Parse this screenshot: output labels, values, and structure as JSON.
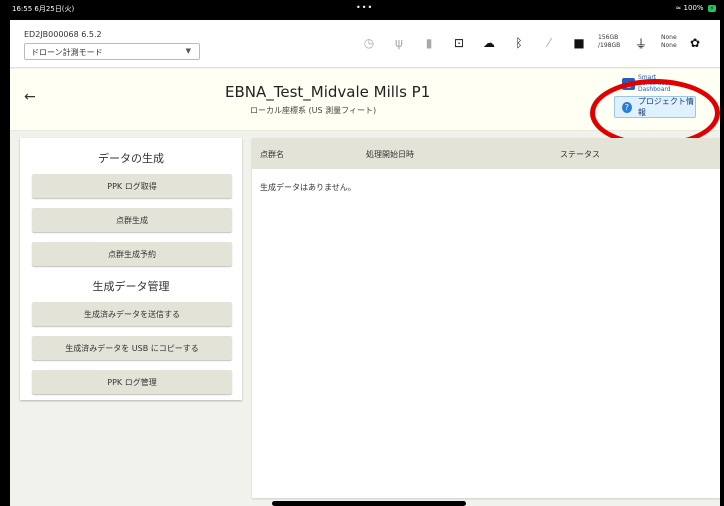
{
  "status_bar": {
    "time": "16:55 6月25日(火)",
    "center_dots": "•••",
    "battery_text": "100%",
    "wifi_icon": "wifi-icon",
    "battery_cell": "⚡"
  },
  "topbar": {
    "device_id": "ED2JB000068 6.5.2",
    "mode_select": "ドローン計測モード",
    "storage": {
      "line1": "156GB",
      "line2": "/198GB"
    },
    "none_status": {
      "line1": "None",
      "line2": "None"
    },
    "icons": [
      "timer-icon",
      "usb-icon",
      "sd-card-icon",
      "download-icon",
      "cloud-icon",
      "antenna-icon",
      "probe-icon",
      "folder-icon",
      "plug-icon",
      "gear-icon"
    ]
  },
  "header": {
    "title": "EBNA_Test_Midvale Mills P1",
    "subtitle": "ローカル座標系 (US 測量フィート)",
    "scd_logo": {
      "line1": "Smart Construction",
      "line2": "Dashboard"
    },
    "project_button": "プロジェクト情報"
  },
  "left_panel": {
    "section1_title": "データの生成",
    "section1_buttons": [
      "PPK ログ取得",
      "点群生成",
      "点群生成予約"
    ],
    "section2_title": "生成データ管理",
    "section2_buttons": [
      "生成済みデータを送信する",
      "生成済みデータを USB にコピーする",
      "PPK ログ管理"
    ]
  },
  "table": {
    "columns": [
      "点群名",
      "処理開始日時",
      "ステータス"
    ],
    "empty_message": "生成データはありません。"
  },
  "colors": {
    "accent_blue": "#2d7cd4",
    "highlight_red": "#e10000",
    "button_bg": "#e3e3d8"
  }
}
